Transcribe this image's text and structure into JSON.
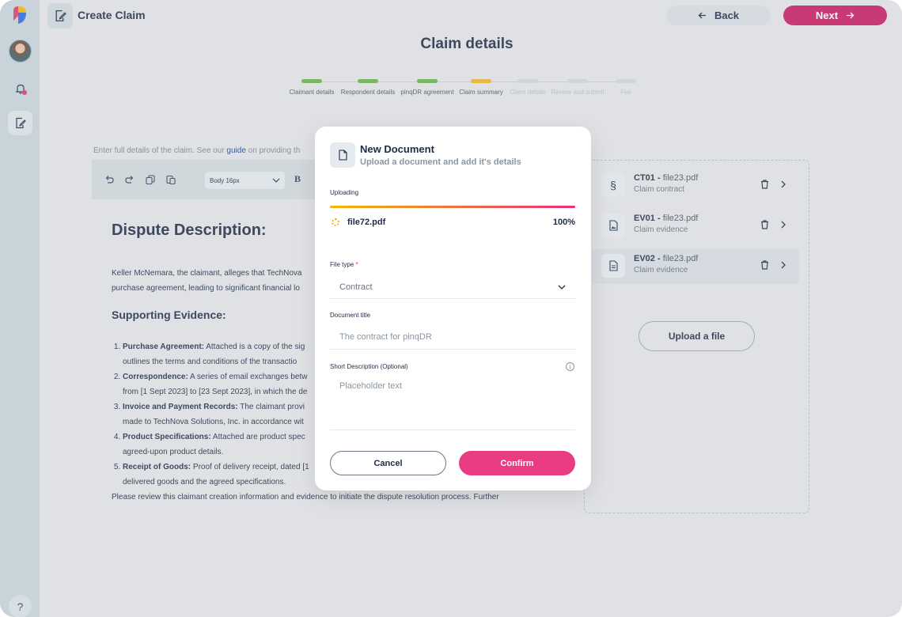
{
  "header": {
    "title": "Create Claim",
    "back_label": "Back",
    "next_label": "Next"
  },
  "page": {
    "title": "Claim details",
    "intro_text": "Enter full details of the claim. See our",
    "intro_link": "guide",
    "intro_rest": "on providing th"
  },
  "stepper": {
    "steps": [
      {
        "label": "Claimant details",
        "status": "done",
        "color": "#6ab04c"
      },
      {
        "label": "Respondent details",
        "status": "done",
        "color": "#6ab04c"
      },
      {
        "label": "pinqDR agreement",
        "status": "done",
        "color": "#6ab04c"
      },
      {
        "label": "Claim summary",
        "status": "current",
        "color": "#f0b429"
      },
      {
        "label": "Claim details",
        "status": "pending",
        "color": "#d1d8dc"
      },
      {
        "label": "Review and submit",
        "status": "pending",
        "color": "#d1d8dc"
      },
      {
        "label": "Fee",
        "status": "pending",
        "color": "#d1d8dc"
      }
    ]
  },
  "editor": {
    "style_select": "Body 16px",
    "bold_label": "B"
  },
  "document": {
    "heading": "Dispute Description:",
    "paragraph1_line1": "Keller McNemara, the claimant, alleges that TechNova",
    "paragraph1_line2": "purchase agreement, leading to significant financial lo",
    "subheading": "Supporting Evidence:",
    "evidence": [
      {
        "title": "Purchase Agreement:",
        "line1": "Attached is a copy of the sig",
        "line2": "outlines the terms and conditions of the transactio"
      },
      {
        "title": "Correspondence:",
        "line1": "A series of email exchanges betw",
        "line2": "from [1 Sept 2023] to [23 Sept 2023], in which the de"
      },
      {
        "title": "Invoice and Payment Records:",
        "line1": "The claimant provi",
        "line2": "made to TechNova Solutions, Inc. in accordance wit"
      },
      {
        "title": "Product Specifications:",
        "line1": "Attached are product spec",
        "line2": "agreed-upon product details."
      },
      {
        "title": "Receipt of Goods:",
        "line1": "Proof of delivery receipt, dated [1",
        "line2": "delivered goods and the agreed specifications."
      }
    ],
    "closing": "Please review this claimant creation information and evidence to initiate the dispute resolution process. Further"
  },
  "files": [
    {
      "code": "CT01",
      "name": "file23.pdf",
      "kind": "Claim contract",
      "icon": "section-icon"
    },
    {
      "code": "EV01",
      "name": "file23.pdf",
      "kind": "Claim evidence",
      "icon": "image-file-icon"
    },
    {
      "code": "EV02",
      "name": "file23.pdf",
      "kind": "Claim evidence",
      "icon": "document-icon"
    }
  ],
  "upload_button": "Upload a file",
  "modal": {
    "title": "New Document",
    "subtitle": "Upload a document and add it's details",
    "uploading_label": "Uploading",
    "file_name": "file72.pdf",
    "progress_text": "100%",
    "progress_value": 1.0,
    "file_type_label": "File type",
    "required_mark": "*",
    "file_type_value": "Contract",
    "doc_title_label": "Document title",
    "doc_title_placeholder": "The contract for pinqDR",
    "short_desc_label": "Short Description (Optional)",
    "short_desc_placeholder": "Placeholder text",
    "cancel_label": "Cancel",
    "confirm_label": "Confirm"
  },
  "colors": {
    "accent": "#c81a62",
    "confirm": "#ea3c82",
    "progress_start": "#f2b705",
    "progress_end": "#e8307a"
  }
}
